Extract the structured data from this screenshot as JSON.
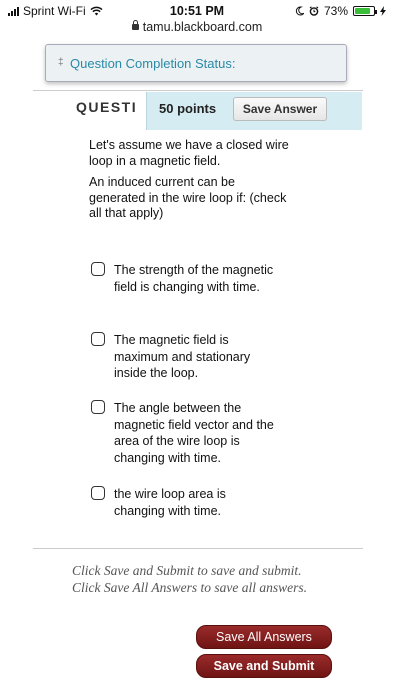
{
  "status_bar": {
    "carrier": "Sprint Wi-Fi",
    "time": "10:51 PM",
    "battery_percent": "73%",
    "battery_level": 0.73,
    "url": "tamu.blackboard.com",
    "icons": [
      "signal-icon",
      "wifi-icon",
      "moon-icon",
      "alarm-icon",
      "battery-icon",
      "charging-icon",
      "lock-icon"
    ]
  },
  "completion": {
    "label": "Question Completion Status:"
  },
  "question": {
    "title": "QUESTI",
    "points": "50 points",
    "save_label": "Save Answer",
    "prompt": [
      "Let's assume we have a closed wire loop in a magnetic field.",
      "An induced current can be generated in the wire loop if: (check all that apply)"
    ],
    "choices": [
      "The strength of the magnetic field is changing with time.",
      "The magnetic field is maximum and stationary inside the loop.",
      "The angle between the magnetic field vector and the area of the wire loop is changing with time.",
      "the wire loop area is changing with time."
    ]
  },
  "footer": {
    "instruction_1": "Click Save and Submit to save and submit.",
    "instruction_2": "Click Save All Answers to save all answers.",
    "save_all_label": "Save All Answers",
    "save_submit_label": "Save and Submit"
  },
  "colors": {
    "accent_link": "#2a8aa6",
    "points_panel": "#d6ecf3",
    "primary_button": "#7d1c1c",
    "battery_fill": "#3bbf3b"
  }
}
